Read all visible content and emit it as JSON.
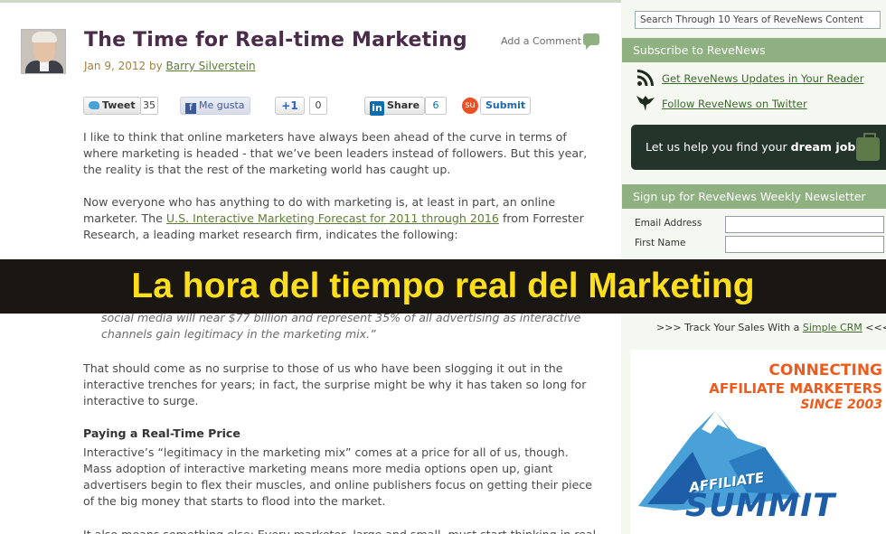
{
  "article": {
    "title": "The Time for Real-time Marketing",
    "date": "Jan 9, 2012",
    "by": "by",
    "author": "Barry Silverstein",
    "add_comment": "Add a Comment",
    "share": {
      "tweet": "Tweet",
      "tweet_count": "35",
      "facebook": "Me gusta",
      "gplus": "+1",
      "gplus_count": "0",
      "linkedin": "Share",
      "linkedin_count": "6",
      "submit": "Submit"
    },
    "p1": "I like to think that online marketers have always been ahead of the curve in terms of where marketing is headed - that we’ve been leaders instead of followers. But this year, the reality is that the rest of the marketing world has caught up.",
    "p2_pre": "Now everyone who has anything to do with marketing is, at least in part, an online marketer. The ",
    "p2_link": "U.S. Interactive Marketing Forecast for 2011 through 2016",
    "p2_post": " from Forrester Research, a leading market research firm, indicates the following:",
    "quote": "social media will near $77 billion and represent 35% of all advertising as interactive channels gain legitimacy in the marketing mix.”",
    "p3": "That should come as no surprise to those of us who have been slogging it out in the interactive trenches for years; in fact, the surprise might be why it has taken so long for interactive to surge.",
    "subheading": "Paying a Real-Time Price",
    "p4": "Interactive’s “legitimacy in the marketing mix” comes at a price for all of us, though. Mass adoption of interactive marketing means more media options open up, giant advertisers begin to flex their muscles, and online publishers focus on getting their piece of the big money that starts to flood into the market.",
    "p5": "It also means something else: Every marketer, large and small, must start thinking in real"
  },
  "sidebar": {
    "search_placeholder": "Search Through 10 Years of ReveNews Content",
    "subscribe_heading": "Subscribe to ReveNews",
    "rss_link": "Get ReveNews Updates in Your Reader",
    "twitter_link": "Follow ReveNews on Twitter",
    "jobs_pre": "Let us help you find your ",
    "jobs_bold": "dream job",
    "newsletter_heading": "Sign up for ReveNews Weekly Newsletter",
    "email_label": "Email Address",
    "first_name_label": "First Name",
    "track_pre": ">>> Track Your Sales With a ",
    "track_link": "Simple CRM",
    "track_post": " <<<",
    "ad": {
      "line1": "CONNECTING",
      "line2": "AFFILIATE MARKETERS",
      "line3": "SINCE 2003",
      "word1": "AFFILIATE",
      "word2": "SUMMIT"
    }
  },
  "overlay": {
    "caption": "La hora del tiempo real del Marketing"
  },
  "colors": {
    "title": "#4a2b4a",
    "green_accent": "#8fb081",
    "link": "#5c7e33",
    "caption_text": "#ffdf1c",
    "caption_bg": "#1a1712"
  }
}
